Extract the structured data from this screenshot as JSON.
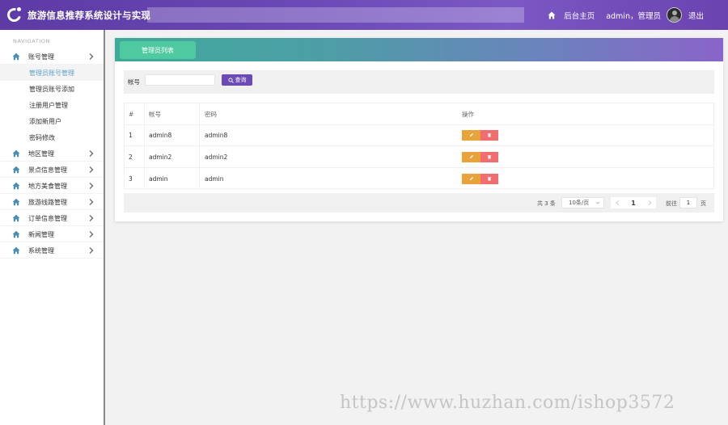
{
  "header": {
    "app_title": "旅游信息推荐系统设计与实现",
    "home_link": "后台主页",
    "user": "admin，管理员",
    "logout": "退出"
  },
  "sidebar": {
    "nav_label": "NAVIGATION",
    "account_menu": {
      "label": "账号管理",
      "items": [
        "管理员账号管理",
        "管理员账号添加",
        "注册用户管理",
        "添加新用户",
        "密码修改"
      ],
      "active_index": 0
    },
    "menus": [
      "地区管理",
      "景点信息管理",
      "地方美食管理",
      "旅游线路管理",
      "订单信息管理",
      "新闻管理",
      "系统管理"
    ]
  },
  "card": {
    "tab_label": "管理员列表"
  },
  "search": {
    "label": "帐号",
    "input_value": "",
    "button_label": "查询"
  },
  "table": {
    "headers": [
      "#",
      "帐号",
      "密码",
      "操作"
    ],
    "rows": [
      {
        "index": "1",
        "account": "admin8",
        "password": "admin8"
      },
      {
        "index": "2",
        "account": "admin2",
        "password": "admin2"
      },
      {
        "index": "3",
        "account": "admin",
        "password": "admin"
      }
    ]
  },
  "pagination": {
    "total": "共 3 条",
    "page_size": "10条/页",
    "current_page": "1",
    "goto_label": "前往",
    "goto_value": "1",
    "page_suffix": "页"
  },
  "watermark": "https://www.huzhan.com/ishop3572",
  "colors": {
    "header": "#6a48b5",
    "tab": "#4ec9a0",
    "search_button": "#6c4ab5",
    "edit_button": "#e8a33a",
    "delete_button": "#f26e6e",
    "active_menu_text": "#5fa0c8"
  }
}
